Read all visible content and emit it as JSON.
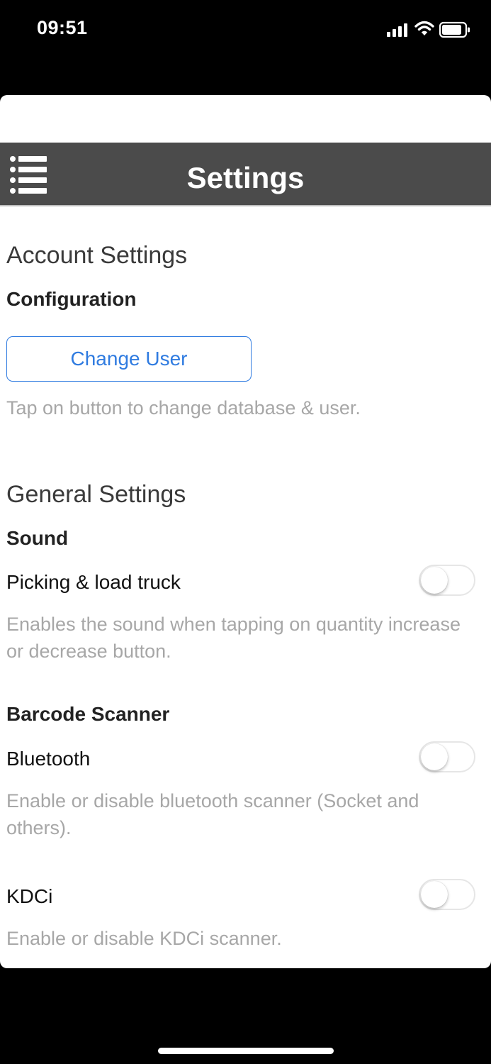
{
  "status_bar": {
    "time": "09:51",
    "icons": [
      "cellular-signal-icon",
      "wifi-icon",
      "battery-icon"
    ]
  },
  "header": {
    "title": "Settings",
    "menu_icon": "list-menu-icon",
    "background_color": "#4b4b4b"
  },
  "account_settings": {
    "heading": "Account Settings",
    "configuration": {
      "label": "Configuration",
      "button_label": "Change User",
      "help": "Tap on button to change database & user."
    }
  },
  "general_settings": {
    "heading": "General Settings",
    "sound": {
      "label": "Sound",
      "picking": {
        "label": "Picking & load truck",
        "enabled": false,
        "help": "Enables the sound when tapping on quantity increase or decrease button."
      }
    },
    "barcode_scanner": {
      "label": "Barcode Scanner",
      "bluetooth": {
        "label": "Bluetooth",
        "enabled": false,
        "help": "Enable or disable bluetooth scanner (Socket and others)."
      },
      "kdci": {
        "label": "KDCi",
        "enabled": false,
        "help": "Enable or disable KDCi scanner."
      }
    }
  },
  "colors": {
    "accent": "#2f7be0",
    "help_text": "#a7a7a7",
    "header": "#4b4b4b"
  }
}
